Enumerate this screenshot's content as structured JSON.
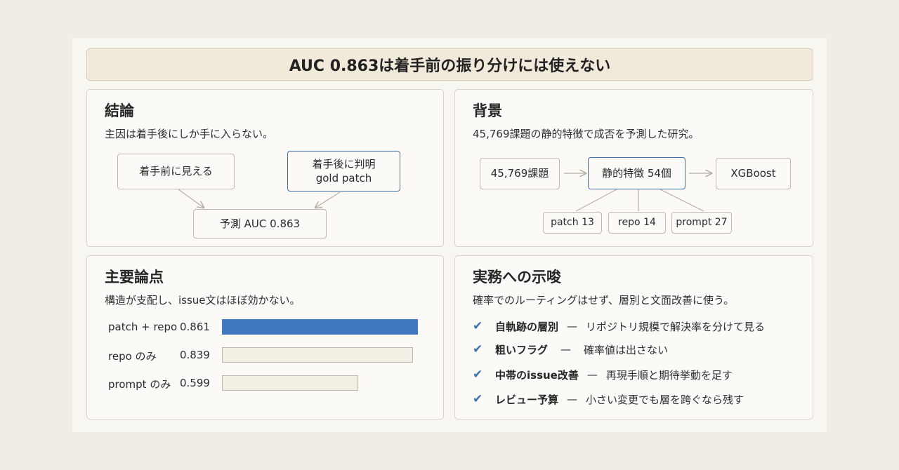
{
  "title": "AUC 0.863は着手前の振り分けには使えない",
  "conclusion": {
    "heading": "結論",
    "subtitle": "主因は着手後にしか手に入らない。",
    "box_before": "着手前に見える",
    "box_after_line1": "着手後に判明",
    "box_after_line2": "gold patch",
    "box_result": "予測 AUC 0.863"
  },
  "background": {
    "heading": "背景",
    "subtitle": "45,769課題の静的特徴で成否を予測した研究。",
    "box_tasks": "45,769課題",
    "box_features": "静的特徴 54個",
    "box_model": "XGBoost",
    "sub_patch": "patch 13",
    "sub_repo": "repo 14",
    "sub_prompt": "prompt 27"
  },
  "points": {
    "heading": "主要論点",
    "subtitle": "構造が支配し、issue文はほぼ効かない。",
    "chart_data": {
      "type": "bar",
      "categories": [
        "patch + repo",
        "repo のみ",
        "prompt のみ"
      ],
      "values": [
        0.861,
        0.839,
        0.599
      ],
      "value_labels": [
        "0.861",
        "0.839",
        "0.599"
      ],
      "highlight_index": 0,
      "colors": {
        "highlight": "#3f78c0",
        "normal": "#f3eee4",
        "normal_border": "#bfb8ab"
      }
    }
  },
  "implications": {
    "heading": "実務への示唆",
    "subtitle": "確率でのルーティングはせず、層別と文面改善に使う。",
    "dash": "—",
    "items": [
      {
        "head": "自軌跡の層別",
        "desc": "リポジトリ規模で解決率を分けて見る"
      },
      {
        "head": "粗いフラグ",
        "desc": "確率値は出さない"
      },
      {
        "head": "中帯のissue改善",
        "desc": "再現手順と期待挙動を足す"
      },
      {
        "head": "レビュー予算",
        "desc": "小さい変更でも層を跨ぐなら残す"
      }
    ]
  },
  "colors": {
    "accent": "#3f6fae",
    "arrow": "#b7b0a3"
  }
}
